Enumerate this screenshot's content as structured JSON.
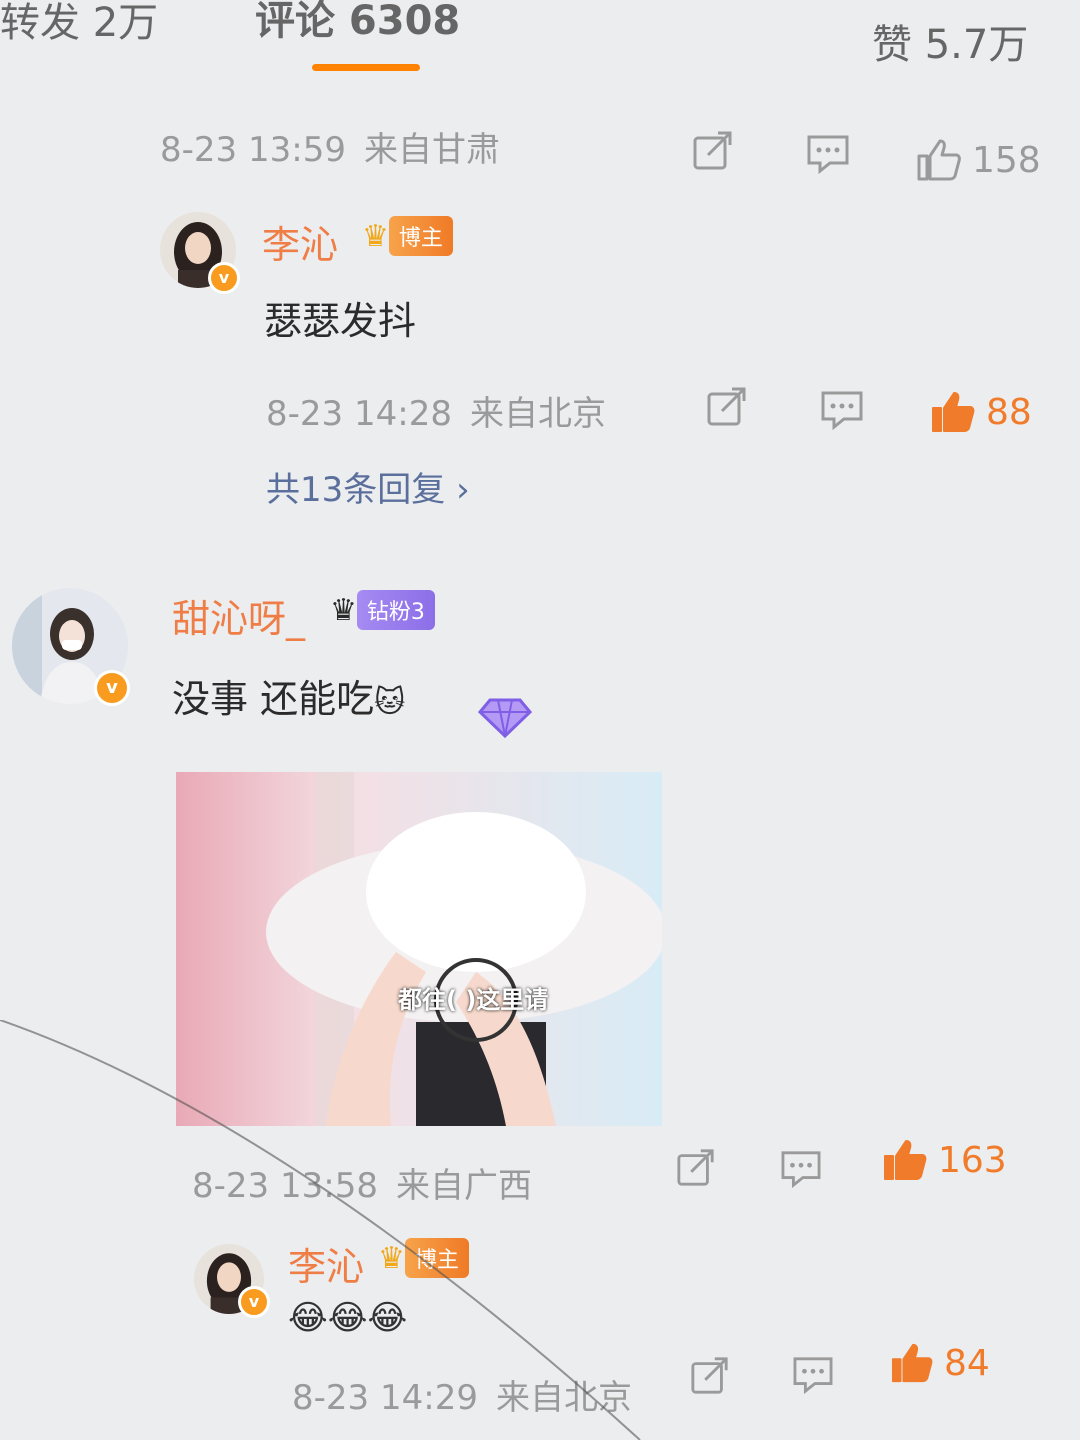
{
  "tabs": {
    "reposts": "转发 2万",
    "comments": "评论 6308",
    "likes": "赞 5.7万"
  },
  "comment1_meta": {
    "time": "8-23 13:59",
    "location": "来自甘肃",
    "like_count": "158"
  },
  "reply1": {
    "username": "李沁",
    "badge_label": "博主",
    "text": "瑟瑟发抖",
    "time": "8-23 14:28",
    "location": "来自北京",
    "like_count": "88",
    "replies_link": "共13条回复 ›"
  },
  "comment2": {
    "username": "甜沁呀_",
    "badge_label": "钻粉3",
    "text": "没事 还能吃",
    "text_emoji": "🐱",
    "image_caption": "都往(           )这里请",
    "time": "8-23 13:58",
    "location": "来自广西",
    "like_count": "163"
  },
  "reply2": {
    "username": "李沁",
    "badge_label": "博主",
    "emojis": "😂😂😂",
    "time": "8-23 14:29",
    "location": "来自北京",
    "like_count": "84"
  },
  "icons": {
    "repost": "share-icon",
    "comment": "comment-icon",
    "like": "thumbs-up-icon",
    "verified": "verified-badge-icon"
  },
  "colors": {
    "accent": "#ff8200",
    "username": "#ef7d46",
    "liked": "#f07b2a",
    "link": "#5b6f9c"
  }
}
